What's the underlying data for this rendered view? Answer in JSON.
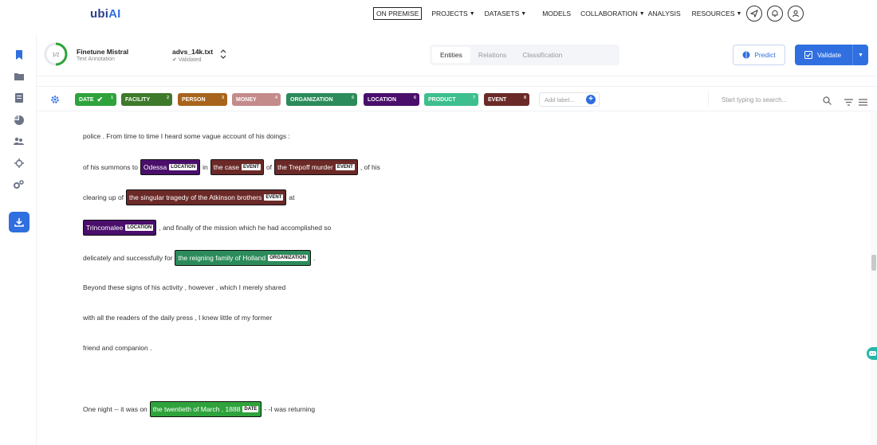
{
  "app": {
    "logo_main": "ubi",
    "logo_accent": "AI"
  },
  "nav": {
    "on_premise": "ON PREMISE",
    "projects": "PROJECTS",
    "datasets": "DATASETS",
    "models": "MODELS",
    "collaboration": "COLLABORATION",
    "analysis": "ANALYSIS",
    "resources": "RESOURCES"
  },
  "sidebar": {
    "icons": [
      "bookmark-icon",
      "folder-icon",
      "document-icon",
      "pie-chart-icon",
      "users-icon",
      "target-icon",
      "settings-icon",
      "download-icon"
    ]
  },
  "project": {
    "progress_text": "1/2",
    "name": "Finetune Mistral",
    "type": "Text Annotation",
    "file_name": "advs_14k.txt",
    "file_status": "Validated"
  },
  "tabs": [
    {
      "label": "Entities",
      "active": true
    },
    {
      "label": "Relations",
      "active": false
    },
    {
      "label": "Classification",
      "active": false
    }
  ],
  "actions": {
    "predict": "Predict",
    "validate": "Validate"
  },
  "labels": [
    {
      "name": "DATE",
      "count": "1",
      "color": "#2ea33b"
    },
    {
      "name": "FACILITY",
      "count": "2",
      "color": "#3d7a2a"
    },
    {
      "name": "PERSON",
      "count": "3",
      "color": "#a8641c"
    },
    {
      "name": "MONEY",
      "count": "4",
      "color": "#c48b8b"
    },
    {
      "name": "ORGANIZATION",
      "count": "5",
      "color": "#2c8b5a"
    },
    {
      "name": "LOCATION",
      "count": "6",
      "color": "#4a0f6b"
    },
    {
      "name": "PRODUCT",
      "count": "7",
      "color": "#3dbf8f"
    },
    {
      "name": "EVENT",
      "count": "8",
      "color": "#6b2a28"
    }
  ],
  "label_input": {
    "placeholder": "Add label..."
  },
  "search": {
    "placeholder": "Start typing to search..."
  },
  "document": {
    "line1": "police . From time to time I heard some vague account of his doings :",
    "line2": {
      "t1": "of his summons to",
      "e1": "Odessa",
      "e1_tag": "LOCATION",
      "t2": "in",
      "e2": "the case",
      "e2_tag": "EVENT",
      "t3": "of",
      "e3": "the Trepoff murder",
      "e3_tag": "EVENT",
      "t4": ", of his"
    },
    "line3": {
      "t1": "clearing up of",
      "e1": "the singular tragedy of the Atkinson brothers",
      "e1_tag": "EVENT",
      "t2": "at"
    },
    "line4": {
      "e1": "Trincomalee",
      "e1_tag": "LOCATION",
      "t1": ", and finally of the mission which he had accomplished so"
    },
    "line5": {
      "t1": "delicately and successfully for",
      "e1": "the reigning family of Holland",
      "e1_tag": "ORGANIZATION",
      "t2": "."
    },
    "line6": "Beyond these signs of his activity , however , which I merely shared",
    "line7": "with all the readers of the daily press , I knew little of my former",
    "line8": "friend and companion .",
    "line9": {
      "t1": "One night -- it was on",
      "e1": "the twentieth of March , 1888",
      "e1_tag": "DATE",
      "t2": "- -I was returning"
    }
  }
}
